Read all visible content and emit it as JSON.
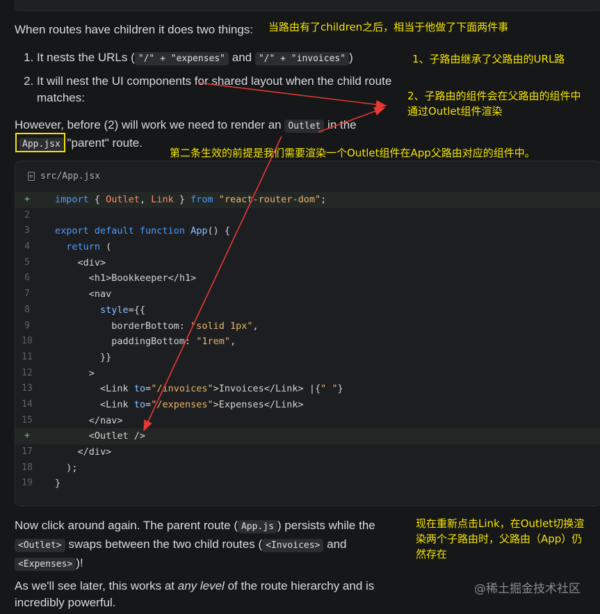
{
  "intro": "When routes have children it does two things:",
  "list": {
    "item1_prefix": "It nests the URLs (",
    "item1_code1": "\"/\" + \"expenses\"",
    "item1_and": " and ",
    "item1_code2": "\"/\" + \"invoices\"",
    "item1_suffix": ")",
    "item2": "It will nest the UI components for shared layout when the child route matches:"
  },
  "however": {
    "prefix": "However, before (2) will work we need to render an ",
    "code": "Outlet",
    "mid": " in the",
    "file_code": "App.jsx",
    "suffix": " \"parent\" route."
  },
  "annotations": {
    "a_intro": "当路由有了children之后，相当于他做了下面两件事",
    "a_one": "1、子路由继承了父路由的URL路",
    "a_two_line1": "2、子路由的组件会在父路由的组件中",
    "a_two_line2": "通过Outlet组件渲染",
    "a_three": "第二条生效的前提是我们需要渲染一个Outlet组件在App父路由对应的组件中。",
    "a_four_line1": "现在重新点击Link，在Outlet切换渲",
    "a_four_line2": "染两个子路由时，父路由（App）仍",
    "a_four_line3": "然存在"
  },
  "code": {
    "filename": "src/App.jsx",
    "lines": [
      {
        "n": "+",
        "added": true
      },
      {
        "n": "2"
      },
      {
        "n": "3"
      },
      {
        "n": "4"
      },
      {
        "n": "5"
      },
      {
        "n": "6"
      },
      {
        "n": "7"
      },
      {
        "n": "8"
      },
      {
        "n": "9"
      },
      {
        "n": "10"
      },
      {
        "n": "11"
      },
      {
        "n": "12"
      },
      {
        "n": "13"
      },
      {
        "n": "14"
      },
      {
        "n": "15"
      },
      {
        "n": "+",
        "added": true
      },
      {
        "n": "17"
      },
      {
        "n": "18"
      },
      {
        "n": "19"
      }
    ]
  },
  "now_click": {
    "p1": "Now click around again. The parent route (",
    "c1": "App.js",
    "p2": ") persists while the",
    "c2": "<Outlet>",
    "p3": " swaps between the two child routes (",
    "c3": "<Invoices>",
    "p4": " and",
    "c4": "<Expenses>",
    "p5": ")!"
  },
  "later": {
    "p1": "As we'll see later, this works at ",
    "em": "any level",
    "p2": " of the route hierarchy and is incredibly powerful."
  },
  "watermark": "@稀土掘金技术社区",
  "colors": {
    "annotation": "#f5e400",
    "arrow": "#e53935",
    "background": "#161719"
  }
}
